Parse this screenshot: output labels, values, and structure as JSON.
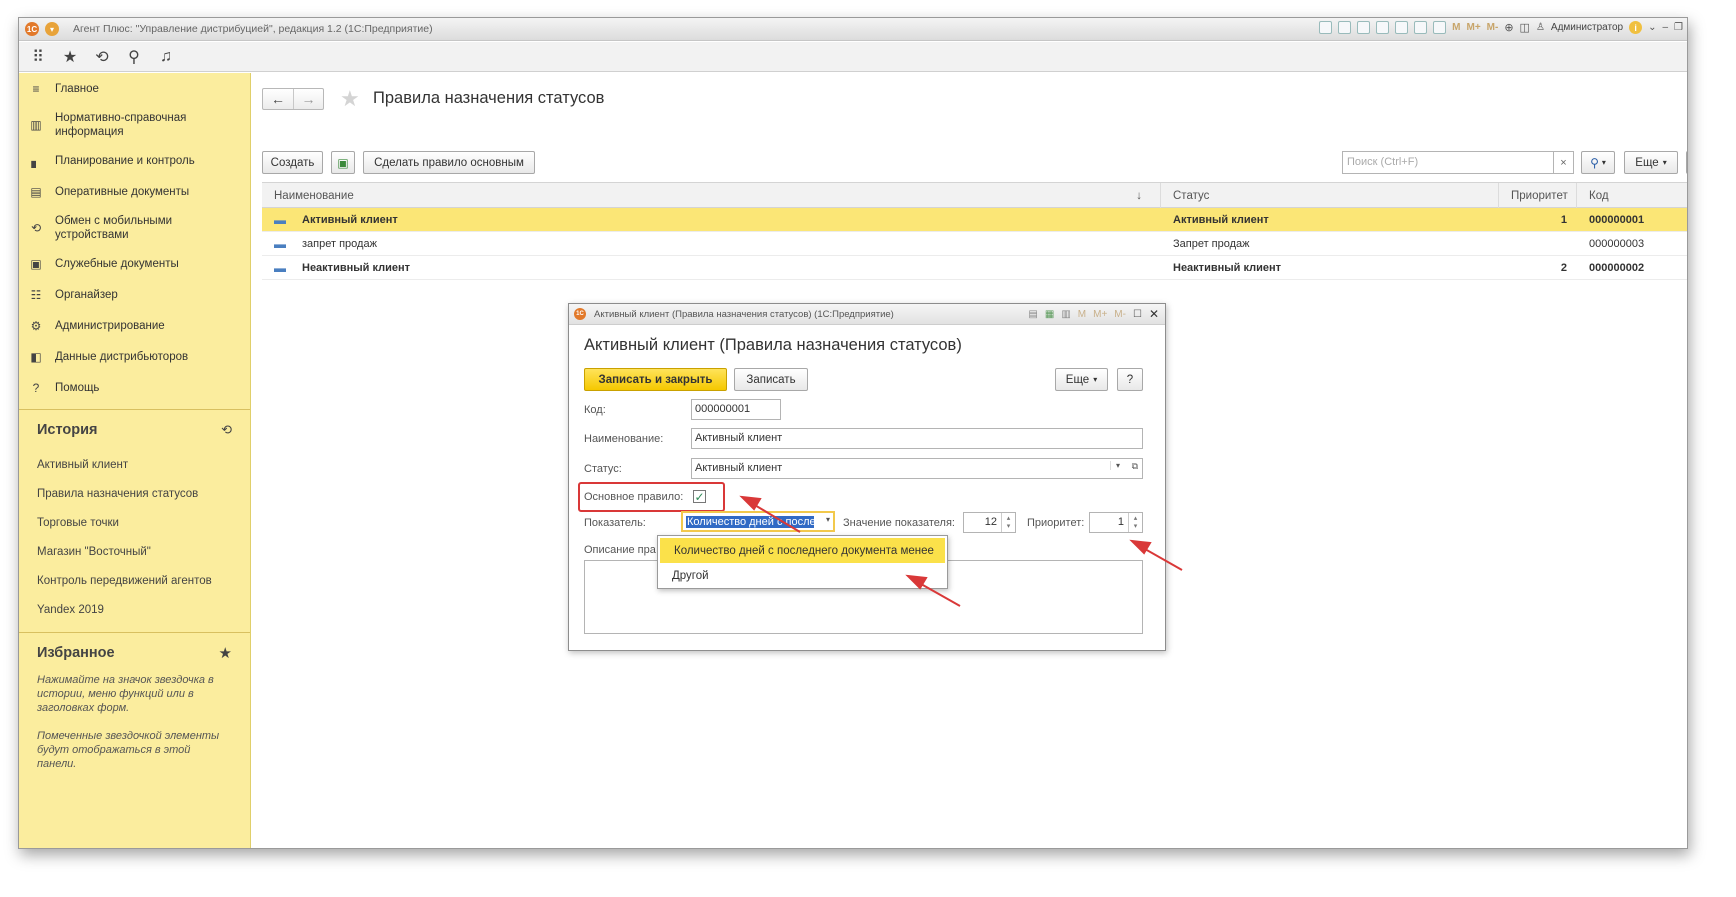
{
  "app": {
    "logo": "1С",
    "title": "Агент Плюс: \"Управление дистрибуцией\", редакция 1.2  (1С:Предприятие)",
    "user": "Администратор",
    "memory_buttons": [
      "M",
      "M+",
      "M-"
    ]
  },
  "toolbar": {
    "icons": [
      "grid-icon",
      "star-icon",
      "history-icon",
      "search-icon",
      "bell-icon"
    ]
  },
  "sidebar": {
    "nav": [
      {
        "label": "Главное",
        "icon": "≡"
      },
      {
        "label": "Нормативно-справочная информация",
        "icon": "▥"
      },
      {
        "label": "Планирование и контроль",
        "icon": "▖"
      },
      {
        "label": "Оперативные документы",
        "icon": "▤"
      },
      {
        "label": "Обмен с мобильными устройствами",
        "icon": "⟲"
      },
      {
        "label": "Служебные документы",
        "icon": "▣"
      },
      {
        "label": "Органайзер",
        "icon": "☷"
      },
      {
        "label": "Администрирование",
        "icon": "⚙"
      },
      {
        "label": "Данные дистрибьюторов",
        "icon": "◧"
      },
      {
        "label": "Помощь",
        "icon": "?"
      }
    ],
    "history_title": "История",
    "history": [
      "Активный клиент",
      "Правила назначения статусов",
      "Торговые точки",
      "Магазин \"Восточный\"",
      "Контроль передвижений агентов",
      "Yandex 2019"
    ],
    "favorites_title": "Избранное",
    "favorites_notes": [
      "Нажимайте на значок звездочка в истории, меню функций или в заголовках форм.",
      "Помеченные звездочкой элементы будут отображаться в этой панели."
    ]
  },
  "main": {
    "title": "Правила назначения статусов",
    "create_label": "Создать",
    "make_main_label": "Сделать правило основным",
    "search_placeholder": "Поиск (Ctrl+F)",
    "search_clear": "×",
    "more_label": "Еще",
    "help_label": "?",
    "columns": {
      "name": "Наименование",
      "sort": "↓",
      "status": "Статус",
      "priority": "Приоритет",
      "code": "Код"
    },
    "rows": [
      {
        "name": "Активный клиент",
        "status": "Активный клиент",
        "priority": "1",
        "code": "000000001"
      },
      {
        "name": "запрет продаж",
        "status": "Запрет продаж",
        "priority": "",
        "code": "000000003"
      },
      {
        "name": "Неактивный клиент",
        "status": "Неактивный клиент",
        "priority": "2",
        "code": "000000002"
      }
    ]
  },
  "dialog": {
    "window_title": "Активный клиент (Правила назначения статусов)  (1С:Предприятие)",
    "heading": "Активный клиент (Правила назначения статусов)",
    "save_close_label": "Записать и закрыть",
    "save_label": "Записать",
    "more_label": "Еще",
    "help_label": "?",
    "code_label": "Код:",
    "code_value": "000000001",
    "name_label": "Наименование:",
    "name_value": "Активный клиент",
    "status_label": "Статус:",
    "status_value": "Активный клиент",
    "main_rule_label": "Основное правило:",
    "main_rule_checked": "✓",
    "indicator_label": "Показатель:",
    "indicator_value": "Количество дней с последнег",
    "indicator_value_label": "Значение показателя:",
    "indicator_number": "12",
    "priority_label": "Приоритет:",
    "priority_value": "1",
    "description_label": "Описание пра"
  },
  "dropdown": {
    "options": [
      "Количество дней с последнего документа менее",
      "Другой"
    ]
  },
  "colors": {
    "sidebar_bg": "#fbed9e",
    "selection": "#fbe676",
    "primary_button": "#f5c800",
    "annotation_red": "#d93838"
  }
}
